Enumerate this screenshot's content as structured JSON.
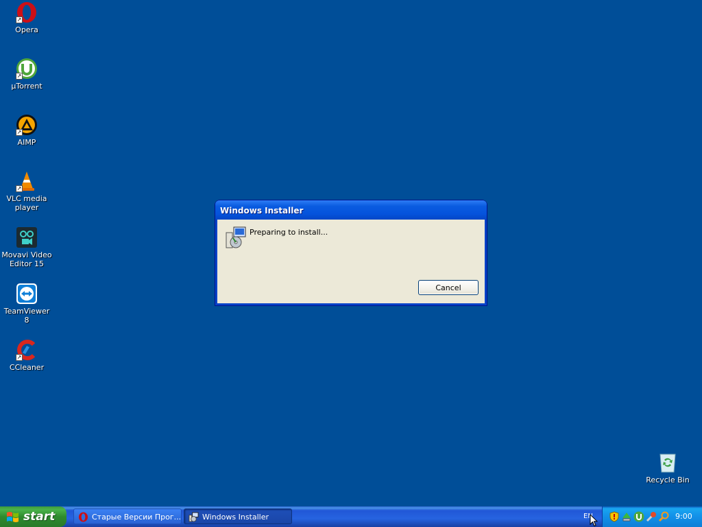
{
  "desktop": {
    "icons": [
      {
        "label": "Opera",
        "icon": "opera-icon"
      },
      {
        "label": "µTorrent",
        "icon": "utorrent-icon"
      },
      {
        "label": "AIMP",
        "icon": "aimp-icon"
      },
      {
        "label": "VLC media player",
        "icon": "vlc-icon"
      },
      {
        "label": "Movavi Video Editor 15",
        "icon": "movavi-icon"
      },
      {
        "label": "TeamViewer 8",
        "icon": "teamviewer-icon"
      },
      {
        "label": "CCleaner",
        "icon": "ccleaner-icon"
      },
      {
        "label": "Recycle Bin",
        "icon": "recycle-bin-icon"
      }
    ],
    "background_color": "#004e98"
  },
  "dialog": {
    "title": "Windows Installer",
    "message": "Preparing to install...",
    "cancel_label": "Cancel",
    "icon": "installer-icon"
  },
  "taskbar": {
    "start_label": "start",
    "tasks": [
      {
        "label": "Старые Версии Прог...",
        "icon": "opera-icon",
        "active": false
      },
      {
        "label": "Windows Installer",
        "icon": "installer-icon",
        "active": true
      }
    ],
    "language": "EN",
    "tray_icons": [
      "security-shield-icon",
      "safely-remove-hardware-icon",
      "utorrent-tray-icon",
      "tools-icon",
      "search-icon"
    ],
    "clock": "9:00"
  }
}
